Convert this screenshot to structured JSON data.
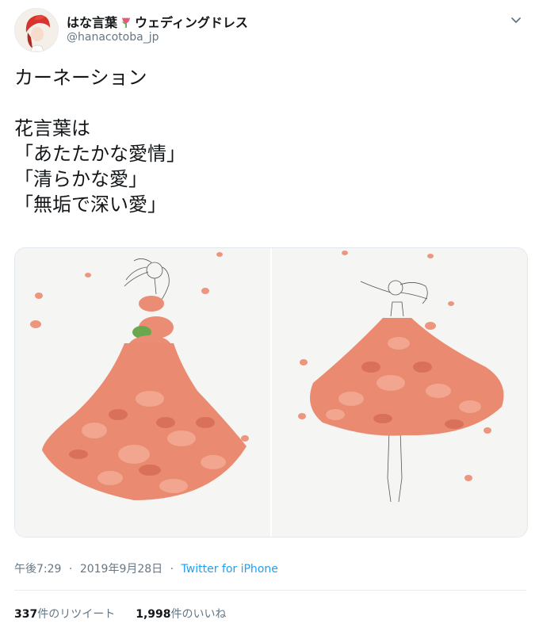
{
  "author": {
    "display_name_part1": "はな言葉",
    "display_name_part2": "ウェディングドレス",
    "handle": "@hanacotoba_jp"
  },
  "tweet": {
    "text": "カーネーション\n\n花言葉は\n「あたたかな愛情」\n「清らかな愛」\n「無垢で深い愛」"
  },
  "meta": {
    "time": "午後7:29",
    "separator": "·",
    "date": "2019年9月28日",
    "source": "Twitter for iPhone"
  },
  "stats": {
    "retweets_count": "337",
    "retweets_label": "件のリツイート",
    "likes_count": "1,998",
    "likes_label": "件のいいね"
  },
  "icons": {
    "avatar": "avatar-image",
    "tulip": "tulip-icon",
    "caret": "chevron-down-icon"
  },
  "colors": {
    "link": "#1da1f2",
    "muted": "#657786",
    "petal": "#e98a73"
  }
}
